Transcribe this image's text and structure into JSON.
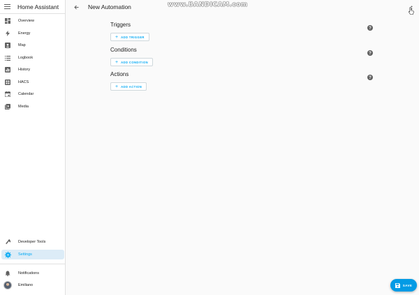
{
  "app": {
    "title": "Home Assistant"
  },
  "sidebar": {
    "items": [
      {
        "label": "Overview",
        "icon": "dashboard-icon"
      },
      {
        "label": "Energy",
        "icon": "lightning-icon"
      },
      {
        "label": "Map",
        "icon": "map-icon"
      },
      {
        "label": "Logbook",
        "icon": "list-icon"
      },
      {
        "label": "History",
        "icon": "chart-box-icon"
      },
      {
        "label": "HACS",
        "icon": "hacs-icon"
      },
      {
        "label": "Calendar",
        "icon": "calendar-icon"
      },
      {
        "label": "Media",
        "icon": "media-icon"
      }
    ],
    "bottom_items": [
      {
        "label": "Developer Tools",
        "icon": "hammer-icon"
      },
      {
        "label": "Settings",
        "icon": "gear-icon",
        "active": true
      }
    ],
    "notifications_label": "Notifications",
    "user_name": "Emiliano"
  },
  "topbar": {
    "title": "New Automation"
  },
  "watermark": "www.BANDICAM.com",
  "sections": [
    {
      "title": "Triggers",
      "button": "ADD TRIGGER"
    },
    {
      "title": "Conditions",
      "button": "ADD CONDITION"
    },
    {
      "title": "Actions",
      "button": "ADD ACTION"
    }
  ],
  "fab": {
    "label": "SAVE"
  },
  "colors": {
    "accent": "#03a9f4",
    "fab": "#039be5",
    "active_bg": "#dcecf7",
    "icon": "#616161"
  }
}
